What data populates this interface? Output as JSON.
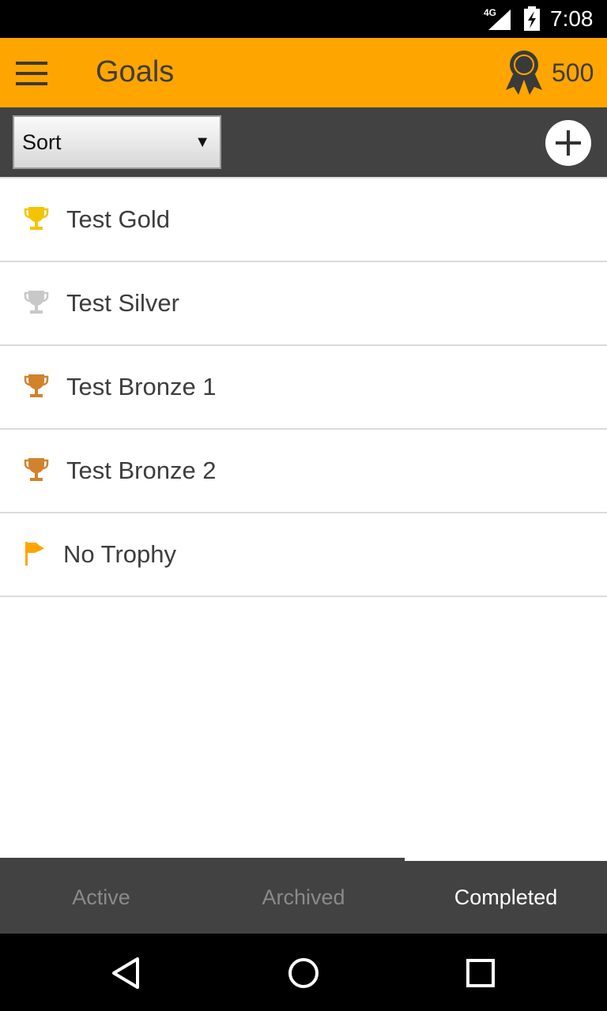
{
  "status_bar": {
    "network": "4G",
    "time": "7:08"
  },
  "app_bar": {
    "title": "Goals",
    "points": "500",
    "points_icon": "award-ribbon-icon",
    "menu_icon": "hamburger-menu-icon"
  },
  "toolbar": {
    "sort_label": "Sort",
    "add_icon": "plus-icon"
  },
  "goals": [
    {
      "name": "Test Gold",
      "icon": "trophy-icon",
      "color": "#F5C400"
    },
    {
      "name": "Test Silver",
      "icon": "trophy-icon",
      "color": "#C8C8C8"
    },
    {
      "name": "Test Bronze 1",
      "icon": "trophy-icon",
      "color": "#D2822D"
    },
    {
      "name": "Test Bronze 2",
      "icon": "trophy-icon",
      "color": "#D2822D"
    },
    {
      "name": "No Trophy",
      "icon": "flag-icon",
      "color": "#FFA500"
    }
  ],
  "tabs": [
    {
      "label": "Active",
      "selected": false
    },
    {
      "label": "Archived",
      "selected": false
    },
    {
      "label": "Completed",
      "selected": true
    }
  ],
  "colors": {
    "accent": "#FFA500",
    "toolbar": "#424242"
  }
}
